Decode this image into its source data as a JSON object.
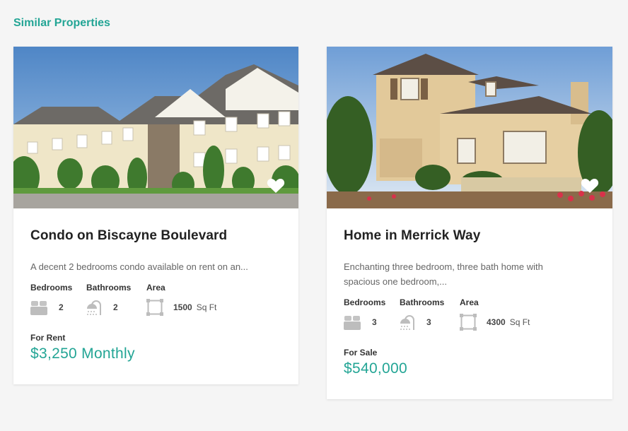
{
  "section": {
    "title": "Similar Properties"
  },
  "colors": {
    "accent": "#23a595",
    "icon": "#bdbdbd"
  },
  "cards": [
    {
      "title": "Condo on Biscayne Boulevard",
      "description": "A decent 2 bedrooms condo available on rent on an...",
      "features": {
        "bedrooms_label": "Bedrooms",
        "bedrooms": "2",
        "bathrooms_label": "Bathrooms",
        "bathrooms": "2",
        "area_label": "Area",
        "area": "1500",
        "area_unit": "Sq Ft"
      },
      "status": "For Rent",
      "price": "$3,250 Monthly",
      "favorite_icon": "heart-icon"
    },
    {
      "title": "Home in Merrick Way",
      "description": "Enchanting three bedroom, three bath home with\nspacious one bedroom,...",
      "features": {
        "bedrooms_label": "Bedrooms",
        "bedrooms": "3",
        "bathrooms_label": "Bathrooms",
        "bathrooms": "3",
        "area_label": "Area",
        "area": "4300",
        "area_unit": "Sq Ft"
      },
      "status": "For Sale",
      "price": "$540,000",
      "favorite_icon": "heart-icon"
    }
  ]
}
